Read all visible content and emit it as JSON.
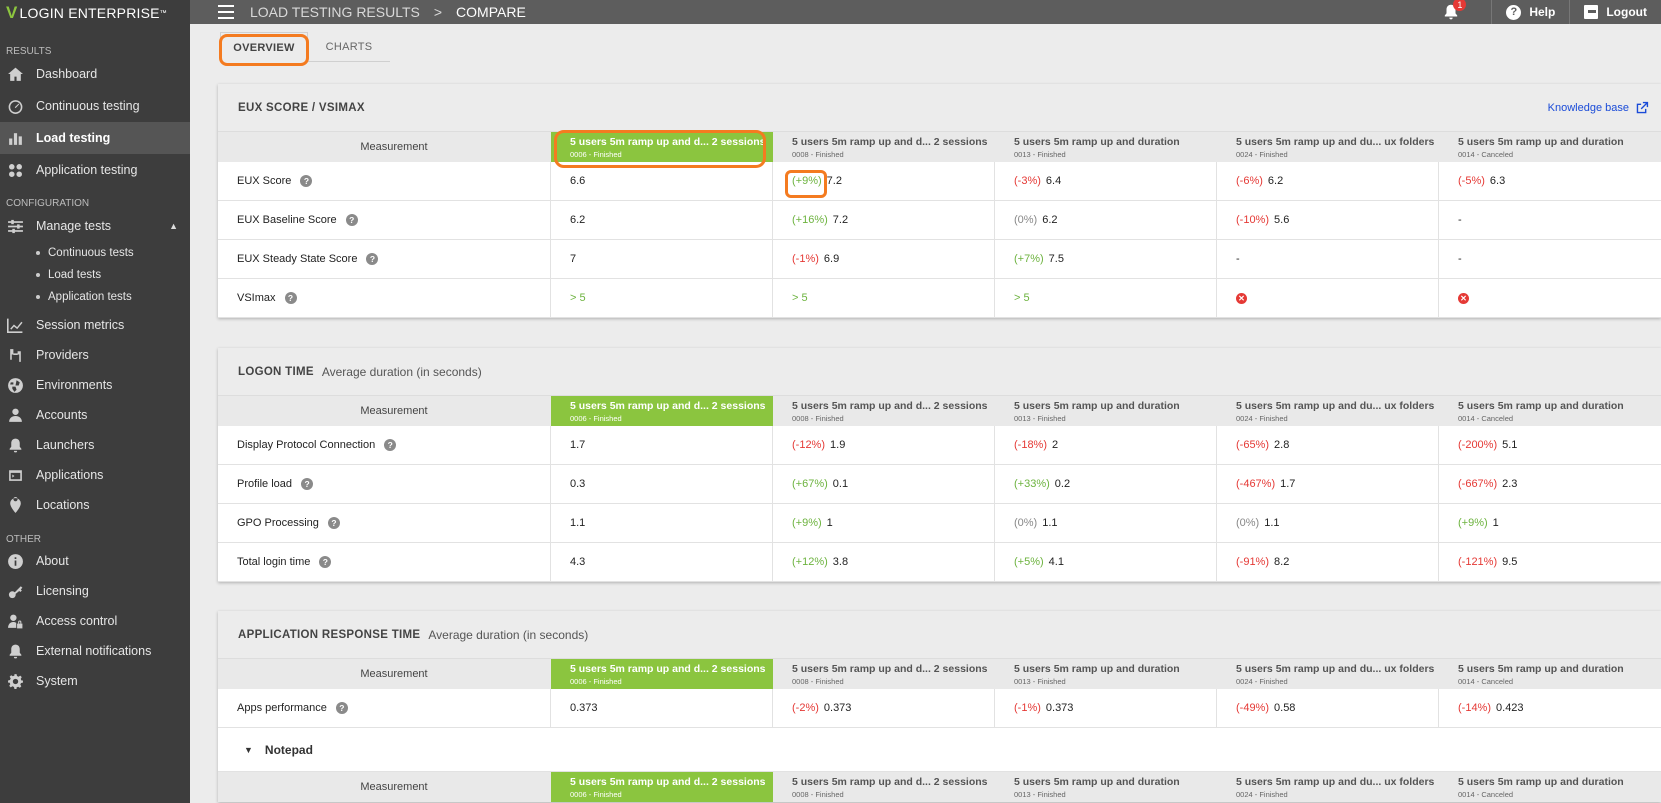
{
  "brand": {
    "name": "LOGIN ENTERPRISE",
    "tm": "™"
  },
  "sidebar": {
    "sections": [
      {
        "title": "RESULTS",
        "items": [
          {
            "label": "Dashboard",
            "icon": "home-icon"
          },
          {
            "label": "Continuous testing",
            "icon": "gauge-icon"
          },
          {
            "label": "Load testing",
            "icon": "bar-chart-icon",
            "active": true
          },
          {
            "label": "Application testing",
            "icon": "apps-grid-icon"
          }
        ]
      },
      {
        "title": "CONFIGURATION",
        "items": [
          {
            "label": "Manage tests",
            "icon": "sliders-icon"
          }
        ]
      }
    ],
    "sub_items": [
      "Continuous tests",
      "Load tests",
      "Application tests"
    ],
    "more_items": [
      {
        "label": "Session metrics",
        "icon": "line-chart-icon"
      },
      {
        "label": "Providers",
        "icon": "providers-icon"
      },
      {
        "label": "Environments",
        "icon": "globe-icon"
      },
      {
        "label": "Accounts",
        "icon": "person-icon"
      },
      {
        "label": "Launchers",
        "icon": "launcher-icon"
      },
      {
        "label": "Applications",
        "icon": "applications-icon"
      },
      {
        "label": "Locations",
        "icon": "pin-icon"
      }
    ],
    "other_title": "OTHER",
    "other_items": [
      {
        "label": "About",
        "icon": "info-icon"
      },
      {
        "label": "Licensing",
        "icon": "key-icon"
      },
      {
        "label": "Access control",
        "icon": "user-lock-icon"
      },
      {
        "label": "External notifications",
        "icon": "bell-icon"
      },
      {
        "label": "System",
        "icon": "gear-icon"
      }
    ]
  },
  "topbar": {
    "crumb1": "LOAD TESTING RESULTS",
    "sep": ">",
    "crumb2": "COMPARE",
    "notif_count": "1",
    "help": "Help",
    "logout": "Logout"
  },
  "tabs": {
    "overview": "OVERVIEW",
    "charts": "CHARTS"
  },
  "columns": [
    {
      "title": "5 users 5m ramp up and d...  2 sessions",
      "sub": "0006 - Finished"
    },
    {
      "title": "5 users 5m ramp up and d...  2 sessions",
      "sub": "0008 - Finished"
    },
    {
      "title": "5 users 5m ramp up and duration",
      "sub": "0013 - Finished"
    },
    {
      "title": "5 users 5m ramp up and du... ux folders",
      "sub": "0024 - Finished"
    },
    {
      "title": "5 users 5m ramp up and duration",
      "sub": "0014 - Canceled"
    }
  ],
  "measurement_label": "Measurement",
  "eux": {
    "title": "EUX SCORE / VSIMAX",
    "kb_link": "Knowledge base",
    "rows": [
      {
        "label": "EUX Score",
        "base": "6.6",
        "cmp": [
          {
            "delta": "(+9%)",
            "val": "7.2"
          },
          {
            "delta": "(-3%)",
            "val": "6.4"
          },
          {
            "delta": "(-6%)",
            "val": "6.2"
          },
          {
            "delta": "(-5%)",
            "val": "6.3"
          }
        ]
      },
      {
        "label": "EUX Baseline Score",
        "base": "6.2",
        "cmp": [
          {
            "delta": "(+16%)",
            "val": "7.2"
          },
          {
            "delta": "(0%)",
            "val": "6.2"
          },
          {
            "delta": "(-10%)",
            "val": "5.6"
          },
          {
            "delta": "",
            "val": "-"
          }
        ]
      },
      {
        "label": "EUX Steady State Score",
        "base": "7",
        "cmp": [
          {
            "delta": "(-1%)",
            "val": "6.9"
          },
          {
            "delta": "(+7%)",
            "val": "7.5"
          },
          {
            "delta": "",
            "val": "-"
          },
          {
            "delta": "",
            "val": "-"
          }
        ]
      },
      {
        "label": "VSImax",
        "base": "> 5",
        "cmp": [
          {
            "delta": "",
            "val": "> 5"
          },
          {
            "delta": "",
            "val": "> 5"
          },
          {
            "delta": "",
            "val": "✕"
          },
          {
            "delta": "",
            "val": "✕"
          }
        ]
      }
    ]
  },
  "logon": {
    "title": "LOGON TIME",
    "subtitle": "Average duration (in seconds)",
    "rows": [
      {
        "label": "Display Protocol Connection",
        "base": "1.7",
        "cmp": [
          {
            "delta": "(-12%)",
            "val": "1.9"
          },
          {
            "delta": "(-18%)",
            "val": "2"
          },
          {
            "delta": "(-65%)",
            "val": "2.8"
          },
          {
            "delta": "(-200%)",
            "val": "5.1"
          }
        ]
      },
      {
        "label": "Profile load",
        "base": "0.3",
        "cmp": [
          {
            "delta": "(+67%)",
            "val": "0.1"
          },
          {
            "delta": "(+33%)",
            "val": "0.2"
          },
          {
            "delta": "(-467%)",
            "val": "1.7"
          },
          {
            "delta": "(-667%)",
            "val": "2.3"
          }
        ]
      },
      {
        "label": "GPO Processing",
        "base": "1.1",
        "cmp": [
          {
            "delta": "(+9%)",
            "val": "1"
          },
          {
            "delta": "(0%)",
            "val": "1.1"
          },
          {
            "delta": "(0%)",
            "val": "1.1"
          },
          {
            "delta": "(+9%)",
            "val": "1"
          }
        ]
      },
      {
        "label": "Total login time",
        "base": "4.3",
        "cmp": [
          {
            "delta": "(+12%)",
            "val": "3.8"
          },
          {
            "delta": "(+5%)",
            "val": "4.1"
          },
          {
            "delta": "(-91%)",
            "val": "8.2"
          },
          {
            "delta": "(-121%)",
            "val": "9.5"
          }
        ]
      }
    ]
  },
  "art": {
    "title": "APPLICATION RESPONSE TIME",
    "subtitle": "Average duration (in seconds)",
    "rows": [
      {
        "label": "Apps performance",
        "base": "0.373",
        "cmp": [
          {
            "delta": "(-2%)",
            "val": "0.373"
          },
          {
            "delta": "(-1%)",
            "val": "0.373"
          },
          {
            "delta": "(-49%)",
            "val": "0.58"
          },
          {
            "delta": "(-14%)",
            "val": "0.423"
          }
        ]
      }
    ],
    "group": "Notepad"
  }
}
